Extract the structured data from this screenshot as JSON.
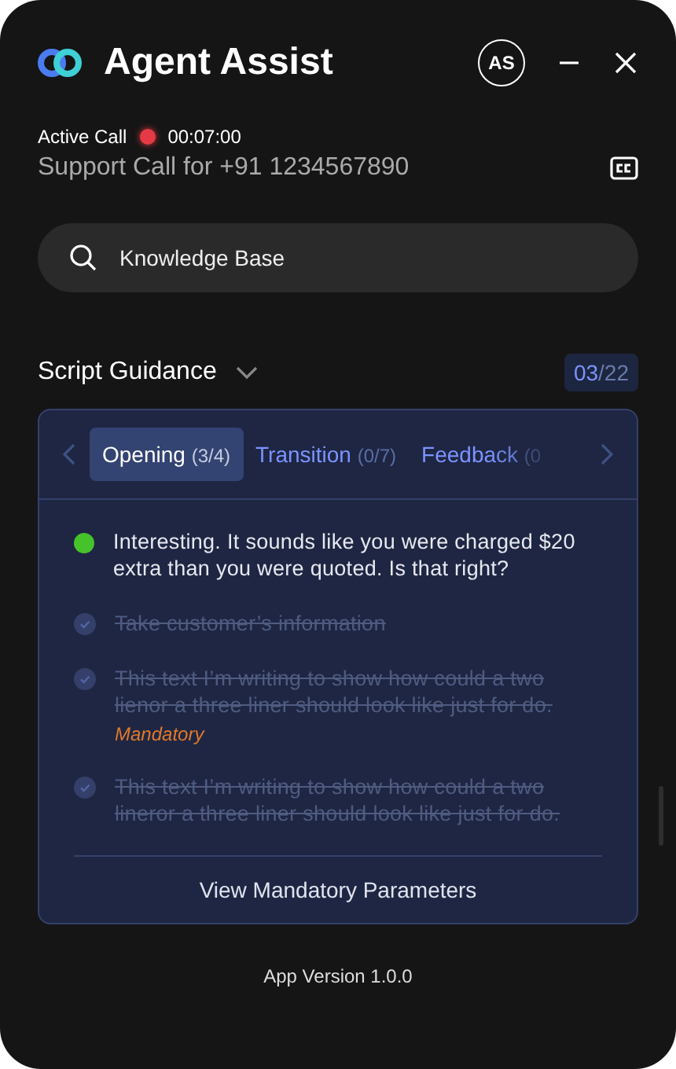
{
  "header": {
    "title": "Agent Assist",
    "avatar": "AS"
  },
  "call": {
    "status": "Active Call",
    "recording": true,
    "timer": "00:07:00",
    "subtitle": "Support Call for +91 1234567890"
  },
  "search": {
    "placeholder": "Knowledge Base"
  },
  "section": {
    "title": "Script Guidance",
    "expanded": false,
    "current": "03",
    "total": "/22"
  },
  "tabs": [
    {
      "label": "Opening",
      "count": "(3/4)",
      "selected": true
    },
    {
      "label": "Transition",
      "count": "(0/7)",
      "selected": false
    },
    {
      "label": "Feedback",
      "count": "(0",
      "selected": false
    }
  ],
  "items": [
    {
      "text": "Interesting. It sounds like you were charged $20 extra than you were quoted. Is that right?",
      "done": false
    },
    {
      "text": "Take customer’s information",
      "done": true
    },
    {
      "text": " This text I’m writing to show how could a two lienor a three liner should look like just for do.",
      "done": true,
      "tag": "Mandatory"
    },
    {
      "text": "This text I’m writing to show how could a two lineror a three liner should look like just for do.",
      "done": true
    }
  ],
  "footer_button": "View Mandatory Parameters",
  "version": "App Version 1.0.0"
}
